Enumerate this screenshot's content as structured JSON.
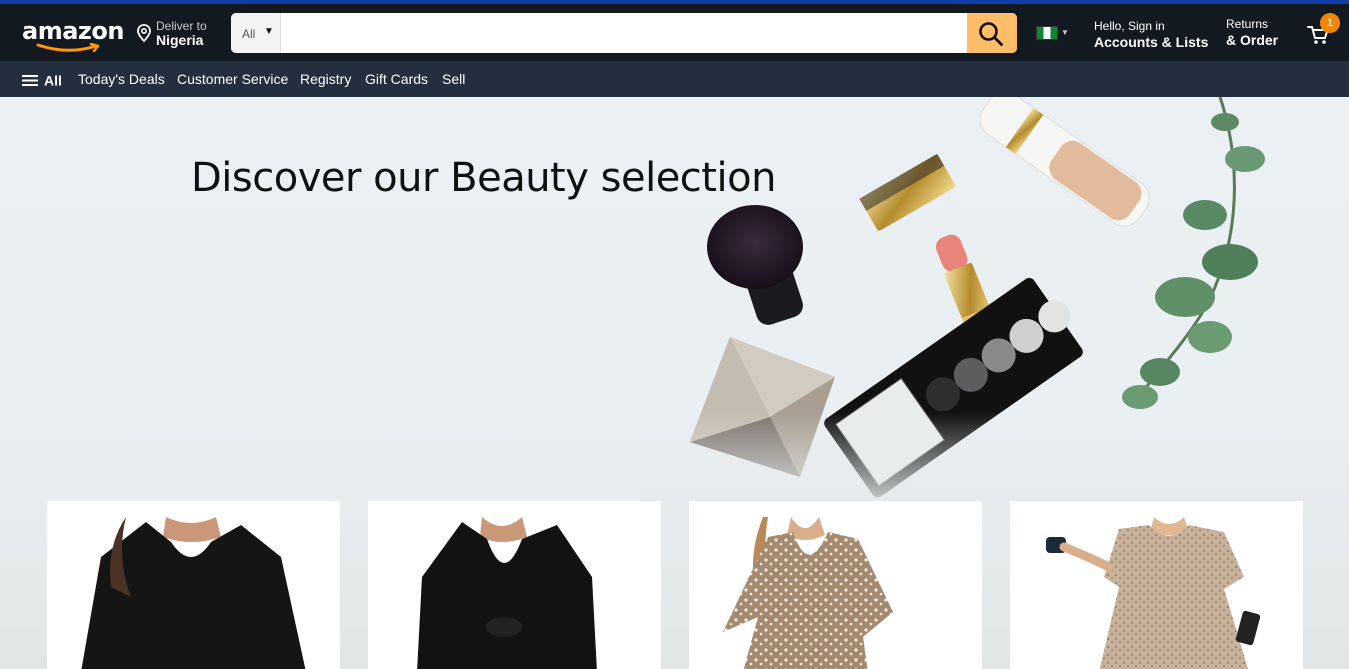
{
  "header": {
    "logo_text": "amazon",
    "deliver_line1": "Deliver to",
    "deliver_line2": "Nigeria",
    "search": {
      "category": "All",
      "value": "",
      "placeholder": ""
    },
    "account_line1": "Hello, Sign in",
    "account_line2": "Accounts & Lists",
    "returns_line1": "Returns",
    "returns_line2": "& Order",
    "cart_count": "1"
  },
  "nav": {
    "all_label": "All",
    "links": [
      "Today's Deals",
      "Customer Service",
      "Registry",
      "Gift Cards",
      "Sell"
    ]
  },
  "hero": {
    "title": "Discover our Beauty selection"
  },
  "colors": {
    "nav_belt": "#131921",
    "nav_main": "#232f3e",
    "search_button": "#febd69",
    "cart_badge": "#f08804"
  },
  "icons": [
    "location-pin-icon",
    "chevron-down-icon",
    "search-icon",
    "nigeria-flag-icon",
    "hamburger-menu-icon",
    "cart-icon"
  ]
}
